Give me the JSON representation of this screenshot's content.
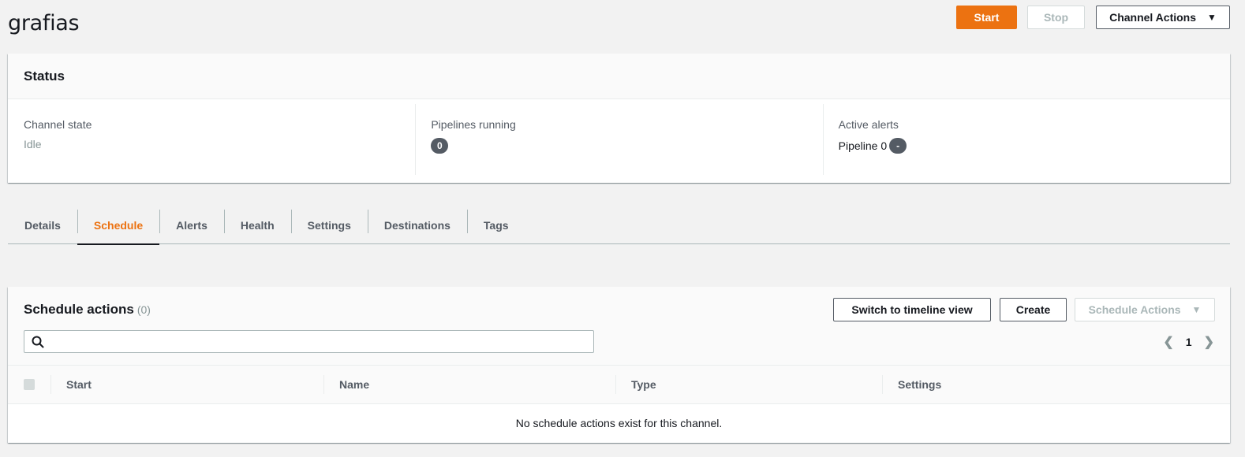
{
  "header": {
    "title": "grafias",
    "start_label": "Start",
    "stop_label": "Stop",
    "channel_actions_label": "Channel Actions"
  },
  "status": {
    "title": "Status",
    "channel_state_label": "Channel state",
    "channel_state_value": "Idle",
    "pipelines_running_label": "Pipelines running",
    "pipelines_running_value": "0",
    "active_alerts_label": "Active alerts",
    "active_alerts_pipeline": "Pipeline 0",
    "active_alerts_value": "-"
  },
  "tabs": [
    {
      "label": "Details",
      "active": false
    },
    {
      "label": "Schedule",
      "active": true
    },
    {
      "label": "Alerts",
      "active": false
    },
    {
      "label": "Health",
      "active": false
    },
    {
      "label": "Settings",
      "active": false
    },
    {
      "label": "Destinations",
      "active": false
    },
    {
      "label": "Tags",
      "active": false
    }
  ],
  "schedule": {
    "title": "Schedule actions",
    "count": "(0)",
    "switch_view_label": "Switch to timeline view",
    "create_label": "Create",
    "schedule_actions_label": "Schedule Actions",
    "search_placeholder": "",
    "page": "1",
    "columns": [
      "Start",
      "Name",
      "Type",
      "Settings"
    ],
    "empty_message": "No schedule actions exist for this channel."
  },
  "colors": {
    "accent": "#ec7211",
    "text": "#16191f",
    "muted": "#879596"
  }
}
